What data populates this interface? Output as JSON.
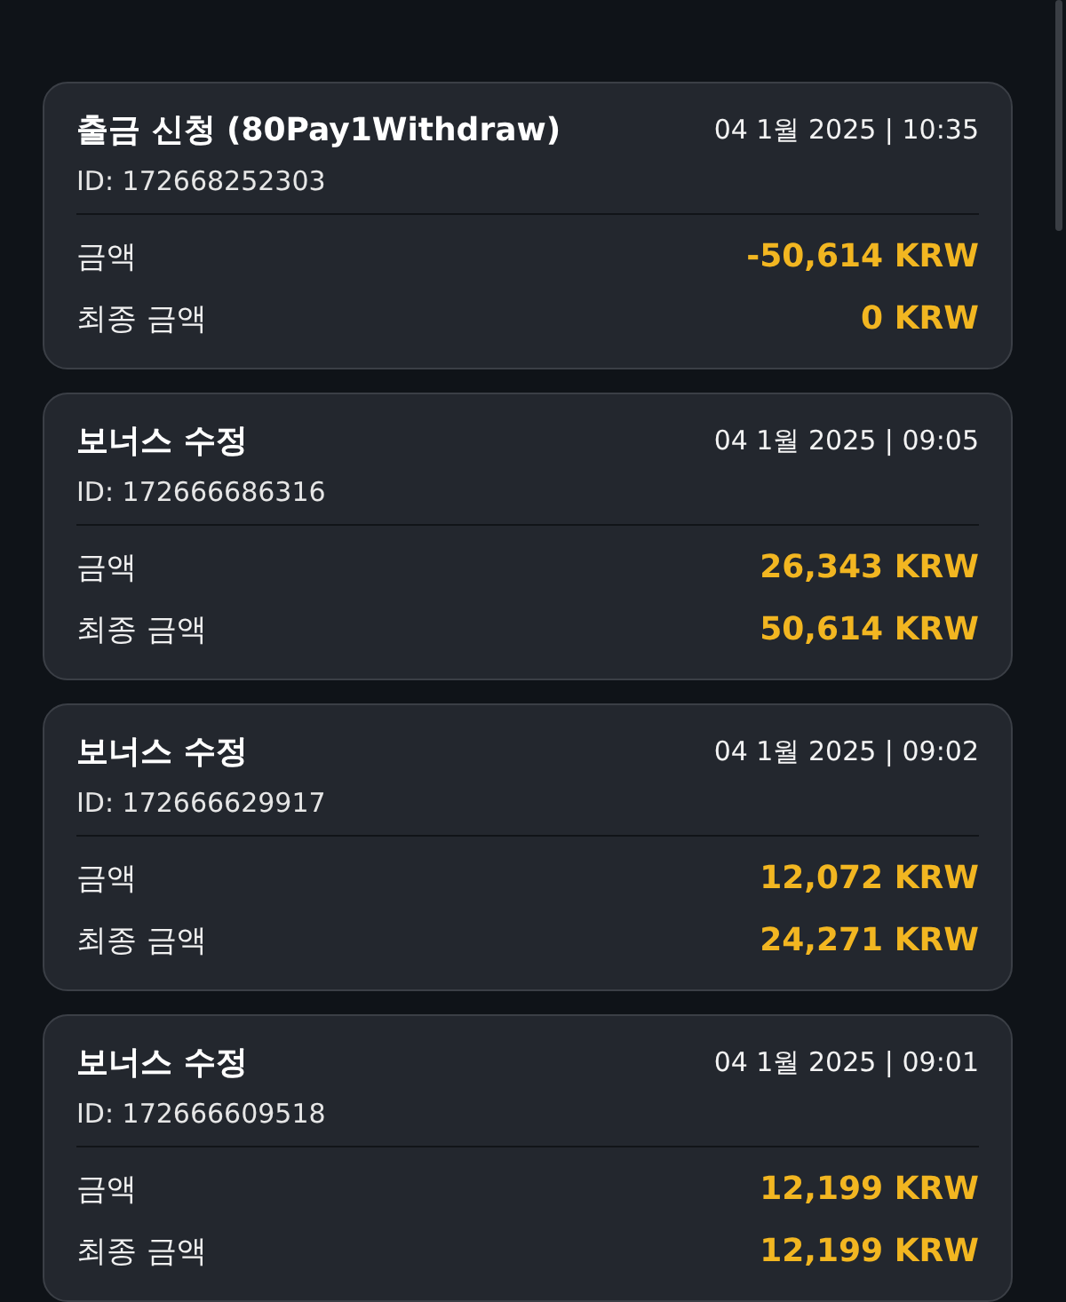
{
  "transactions": [
    {
      "title": "출금 신청 (80Pay1Withdraw)",
      "datetime": "04 1월 2025 | 10:35",
      "id": "ID: 172668252303",
      "rows": [
        {
          "label": "금액",
          "value": "-50,614 KRW"
        },
        {
          "label": "최종 금액",
          "value": "0 KRW"
        }
      ]
    },
    {
      "title": "보너스 수정",
      "datetime": "04 1월 2025 | 09:05",
      "id": "ID: 172666686316",
      "rows": [
        {
          "label": "금액",
          "value": "26,343 KRW"
        },
        {
          "label": "최종 금액",
          "value": "50,614 KRW"
        }
      ]
    },
    {
      "title": "보너스 수정",
      "datetime": "04 1월 2025 | 09:02",
      "id": "ID: 172666629917",
      "rows": [
        {
          "label": "금액",
          "value": "12,072 KRW"
        },
        {
          "label": "최종 금액",
          "value": "24,271 KRW"
        }
      ]
    },
    {
      "title": "보너스 수정",
      "datetime": "04 1월 2025 | 09:01",
      "id": "ID: 172666609518",
      "rows": [
        {
          "label": "금액",
          "value": "12,199 KRW"
        },
        {
          "label": "최종 금액",
          "value": "12,199 KRW"
        }
      ]
    }
  ]
}
